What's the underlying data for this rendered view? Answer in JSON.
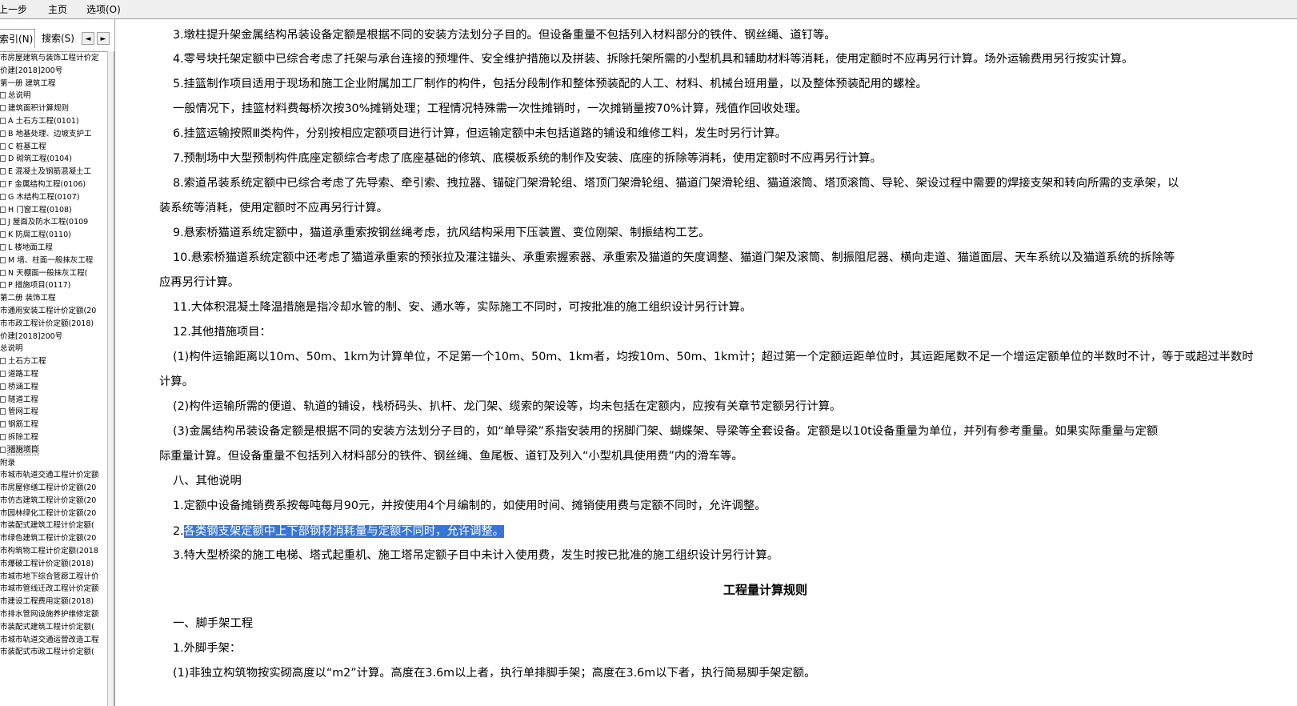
{
  "toolbar": {
    "back_label": "上一步",
    "home_label": "主页",
    "options_label": "选项(O)"
  },
  "left_panel": {
    "tab_index": "索引(N)",
    "tab_search": "搜索(S)",
    "nav_prev": "◄",
    "nav_next": "►",
    "tree": [
      {
        "label": "市房屋建筑与装饰工程计价定",
        "icon": false,
        "indent": 0
      },
      {
        "label": "价建[2018]200号",
        "icon": false,
        "indent": 0
      },
      {
        "label": "第一册 建筑工程",
        "icon": false,
        "indent": 0
      },
      {
        "label": "总说明",
        "icon": true,
        "indent": 0
      },
      {
        "label": "建筑面积计算规则",
        "icon": true,
        "indent": 0
      },
      {
        "label": "A 土石方工程(0101)",
        "icon": true,
        "indent": 0
      },
      {
        "label": "B 地基处理、边坡支护工",
        "icon": true,
        "indent": 0
      },
      {
        "label": "C 桩基工程",
        "icon": true,
        "indent": 0
      },
      {
        "label": "D 砌筑工程(0104)",
        "icon": true,
        "indent": 0
      },
      {
        "label": "E 混凝土及钢筋混凝土工",
        "icon": true,
        "indent": 0
      },
      {
        "label": "F 金属结构工程(0106)",
        "icon": true,
        "indent": 0
      },
      {
        "label": "G 木结构工程(0107)",
        "icon": true,
        "indent": 0
      },
      {
        "label": "H 门窗工程(0108)",
        "icon": true,
        "indent": 0
      },
      {
        "label": "J 屋面及防水工程(0109",
        "icon": true,
        "indent": 0
      },
      {
        "label": "K 防腐工程(0110)",
        "icon": true,
        "indent": 0
      },
      {
        "label": "L 楼地面工程",
        "icon": true,
        "indent": 0
      },
      {
        "label": "M 墙、柱面一般抹灰工程",
        "icon": true,
        "indent": 0
      },
      {
        "label": "N 天棚面一般抹灰工程(",
        "icon": true,
        "indent": 0
      },
      {
        "label": "P 措施项目(0117)",
        "icon": true,
        "indent": 0
      },
      {
        "label": "第二册 装饰工程",
        "icon": false,
        "indent": 0
      },
      {
        "label": "市通用安装工程计价定额(20",
        "icon": false,
        "indent": 0
      },
      {
        "label": "市市政工程计价定额(2018)",
        "icon": false,
        "indent": 0
      },
      {
        "label": "价建[2018]200号",
        "icon": false,
        "indent": 0
      },
      {
        "label": "总说明",
        "icon": false,
        "indent": 0
      },
      {
        "label": "土石方工程",
        "icon": true,
        "indent": 0
      },
      {
        "label": "道路工程",
        "icon": true,
        "indent": 0
      },
      {
        "label": "桥涵工程",
        "icon": true,
        "indent": 0
      },
      {
        "label": "隧道工程",
        "icon": true,
        "indent": 0
      },
      {
        "label": "管网工程",
        "icon": true,
        "indent": 0
      },
      {
        "label": "钢筋工程",
        "icon": true,
        "indent": 0
      },
      {
        "label": "拆除工程",
        "icon": true,
        "indent": 0
      },
      {
        "label": "措施项目",
        "icon": true,
        "indent": 0,
        "selected": true
      },
      {
        "label": "附录",
        "icon": false,
        "indent": 0
      },
      {
        "label": "市城市轨道交通工程计价定额",
        "icon": false,
        "indent": 0
      },
      {
        "label": "市房屋修缮工程计价定额(20",
        "icon": false,
        "indent": 0
      },
      {
        "label": "市仿古建筑工程计价定额(20",
        "icon": false,
        "indent": 0
      },
      {
        "label": "市园林绿化工程计价定额(20",
        "icon": false,
        "indent": 0
      },
      {
        "label": "市装配式建筑工程计价定额(",
        "icon": false,
        "indent": 0
      },
      {
        "label": "市绿色建筑工程计价定额(20",
        "icon": false,
        "indent": 0
      },
      {
        "label": "市构筑物工程计价定额(2018",
        "icon": false,
        "indent": 0
      },
      {
        "label": "市爆破工程计价定额(2018)",
        "icon": false,
        "indent": 0
      },
      {
        "label": "市城市地下综合管廊工程计价",
        "icon": false,
        "indent": 0
      },
      {
        "label": "市城市管线迁改工程计价定额",
        "icon": false,
        "indent": 0
      },
      {
        "label": "市建设工程费用定额(2018)",
        "icon": false,
        "indent": 0
      },
      {
        "label": "市排水管网设施养护维修定额",
        "icon": false,
        "indent": 0
      },
      {
        "label": "市装配式建筑工程计价定额(",
        "icon": false,
        "indent": 0
      },
      {
        "label": "市城市轨道交通运营改造工程",
        "icon": false,
        "indent": 0
      },
      {
        "label": "市装配式市政工程计价定额(",
        "icon": false,
        "indent": 0
      }
    ]
  },
  "content": {
    "paragraphs": [
      "3.墩柱提升架金属结构吊装设备定额是根据不同的安装方法划分子目的。但设备重量不包括列入材料部分的铁件、钢丝绳、道钉等。",
      "4.零号块托架定额中已综合考虑了托架与承台连接的预埋件、安全维护措施以及拼装、拆除托架所需的小型机具和辅助材料等消耗，使用定额时不应再另行计算。场外运输费用另行按实计算。",
      "5.挂篮制作项目适用于现场和施工企业附属加工厂制作的构件，包括分段制作和整体预装配的人工、材料、机械台班用量，以及整体预装配用的螺栓。",
      "一般情况下，挂篮材料费每桥次按30%摊销处理；工程情况特殊需一次性摊销时，一次摊销量按70%计算，残值作回收处理。",
      "6.挂篮运输按照Ⅲ类构件，分别按相应定额项目进行计算，但运输定额中未包括道路的铺设和维修工料，发生时另行计算。",
      "7.预制场中大型预制构件底座定额综合考虑了底座基础的修筑、底模板系统的制作及安装、底座的拆除等消耗，使用定额时不应再另行计算。",
      "8.索道吊装系统定额中已综合考虑了先导索、牵引索、拽拉器、锚碇门架滑轮组、塔顶门架滑轮组、猫道门架滑轮组、猫道滚筒、塔顶滚筒、导轮、架设过程中需要的焊接支架和转向所需的支承架，以",
      "装系统等消耗，使用定额时不应再另行计算。",
      "9.悬索桥猫道系统定额中，猫道承重索按钢丝绳考虑，抗风结构采用下压装置、变位刚架、制振结构工艺。",
      "10.悬索桥猫道系统定额中还考虑了猫道承重索的预张拉及灌注锚头、承重索握索器、承重索及猫道的矢度调整、猫道门架及滚筒、制振阻尼器、横向走道、猫道面层、天车系统以及猫道系统的拆除等",
      "应再另行计算。",
      "11.大体积混凝土降温措施是指冷却水管的制、安、通水等，实际施工不同时，可按批准的施工组织设计另行计算。",
      "12.其他措施项目：",
      "(1)构件运输距离以10m、50m、1km为计算单位，不足第一个10m、50m、1km者，均按10m、50m、1km计；超过第一个定额运距单位时，其运距尾数不足一个增运定额单位的半数时不计，等于或超过半数时",
      "计算。",
      "(2)构件运输所需的便道、轨道的铺设，栈桥码头、扒杆、龙门架、缆索的架设等，均未包括在定额内，应按有关章节定额另行计算。",
      "(3)金属结构吊装设备定额是根据不同的安装方法划分子目的，如“单导梁”系指安装用的拐脚门架、蝴蝶架、导梁等全套设备。定额是以10t设备重量为单位，并列有参考重量。如果实际重量与定额",
      "际重量计算。但设备重量不包括列入材料部分的铁件、钢丝绳、鱼尾板、道钉及列入“小型机具使用费”内的滑车等。",
      "八、其他说明",
      "1.定额中设备摊销费系按每吨每月90元，并按使用4个月编制的，如使用时间、摊销使用费与定额不同时，允许调整。"
    ],
    "p21_prefix": "2.",
    "p21_selected": "各类钢支架定额中上下部钢材消耗量与定额不同时，允许调整。",
    "p22": "3.特大型桥梁的施工电梯、塔式起重机、施工塔吊定额子目中未计入使用费，发生时按已批准的施工组织设计另行计算。",
    "section_title": "工程量计算规则",
    "p23": "一、脚手架工程",
    "p24": "1.外脚手架：",
    "p25": "(1)非独立构筑物按实砌高度以“m2”计算。高度在3.6m以上者，执行单排脚手架；高度在3.6m以下者，执行简易脚手架定额。"
  },
  "colors": {
    "selection": "#3875d7",
    "chrome": "#f0f0f0"
  }
}
